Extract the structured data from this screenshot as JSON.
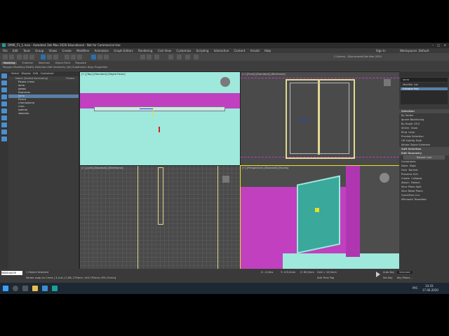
{
  "window": {
    "title": "DMiR_F1_1.max - Autodesk 3ds Max 2020 Educational - Not for Commercial Use"
  },
  "menu": [
    "File",
    "Edit",
    "Tools",
    "Group",
    "Views",
    "Create",
    "Modifiers",
    "Animation",
    "Graph Editors",
    "Rendering",
    "Civil View",
    "Customize",
    "Scripting",
    "Interactive",
    "Content",
    "Arnold",
    "Help"
  ],
  "user": {
    "signin": "Sign In",
    "workspaces": "Workspaces: Default"
  },
  "path": "C:\\Users\\...\\Documents\\3ds Max 2020",
  "ribbon": {
    "tabs": [
      "Modeling",
      "Freeform",
      "Selection",
      "Object Paint",
      "Populate"
    ],
    "sub": "Polygon Modeling  Modify Selection  Edit  Geometry (All)  Subdivision  Align  Properties"
  },
  "scene_explorer": {
    "menu": [
      "Select",
      "Display",
      "Edit",
      "Customize"
    ],
    "header": "Name (Sorted Ascending)",
    "header_right": "Frozen",
    "items": [
      "Рамка стекл",
      "окна",
      "дверь",
      "Картины",
      "окно",
      "Ручка",
      "стекло/окно",
      "стол",
      "цветок",
      "зеркало"
    ]
  },
  "viewports": {
    "top": "[+] [Top] [Standard] [Edged Faces]",
    "front": "[+] [Front] [Standard] [Wireframe]",
    "left": "[+] [Left] [Standard] [Wireframe]",
    "persp": "[+] [Perspective] [Standard] [Facets]"
  },
  "command_panel": {
    "object_name": "окно",
    "modifier_list": "Modifier List",
    "stack_item": "Editable Poly",
    "selection": "Selection",
    "by_vertex": "By Vertex",
    "ignore_backfacing": "Ignore Backfacing",
    "by_angle": "By Angle: 45,0",
    "shrink": "Shrink",
    "grow": "Grow",
    "ring": "Ring",
    "loop": "Loop",
    "preview_selection": "Preview Selection",
    "off": "Off",
    "subobj": "SubObj",
    "multi": "Multi",
    "whole_object": "Whole Object Selected",
    "soft_selection": "Soft Selection",
    "edit_geometry": "Edit Geometry",
    "repeat_last": "Repeat Last",
    "constraints": "Constraints",
    "none": "None",
    "edge": "Edge",
    "face": "Face",
    "normal": "Normal",
    "preserve_uvs": "Preserve UVs",
    "create": "Create",
    "collapse": "Collapse",
    "attach": "Attach",
    "detach": "Detach",
    "slice_plane": "Slice Plane",
    "split": "Split",
    "slice": "Slice",
    "reset_plane": "Reset Plane",
    "quickslice": "QuickSlice",
    "cut": "Cut",
    "msmooth": "MSmooth",
    "tessellate": "Tessellate"
  },
  "timeline": {
    "frame": "0 / 100"
  },
  "status": {
    "selected": "1 Object Selected",
    "prompt": "Vertex snap on Cmna | 3-4 at [ 0,0B; 270mm; 145,735mm; 831,51mm]",
    "x": "X: -0,0ms",
    "y": "Y: 125,0mm",
    "z": "Z: 60,0mm",
    "grid": "Grid = 10,0mm",
    "autokey": "Auto Key",
    "selected_dd": "Selected",
    "setkey": "Set Key",
    "keyfilters": "Key Filters...",
    "addtime": "Add Time Tag"
  },
  "maxscript": "MAXScript Mi",
  "taskbar": {
    "time": "14:33",
    "date": "17.06.2020",
    "lang": "РУС"
  },
  "colors": {
    "magenta": "#c040c0",
    "cyan": "#9fe8dc",
    "teal": "#3aa89a",
    "selection_blue": "#5a7fa8",
    "accent": "#4a8fd0"
  }
}
